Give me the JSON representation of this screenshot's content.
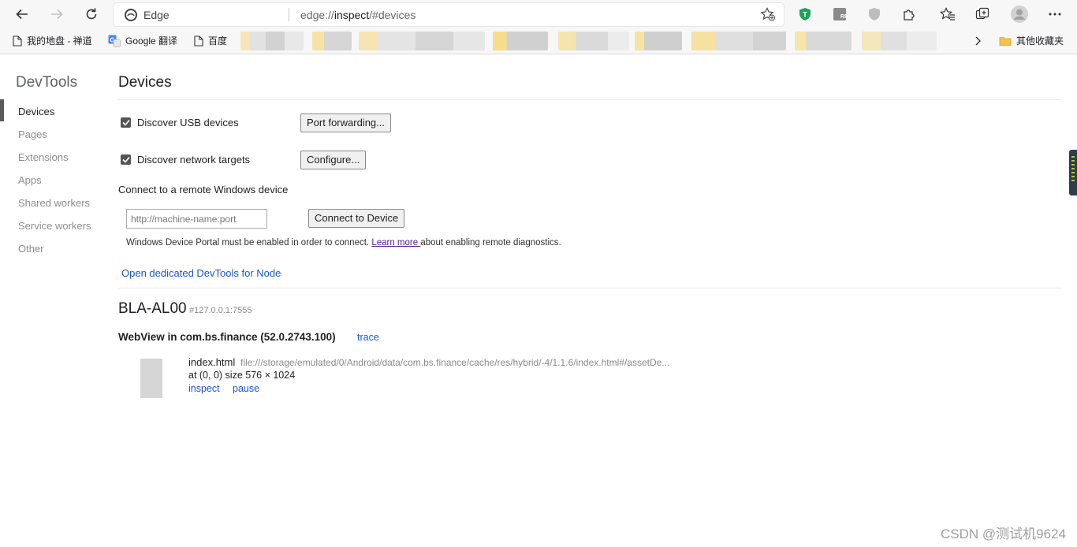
{
  "browser": {
    "edge_label": "Edge",
    "url_scheme": "edge://",
    "url_host": "inspect",
    "url_path": "/#devices"
  },
  "bookmarks": {
    "items": [
      "我的地盘 - 禅道",
      "Google 翻译",
      "百度"
    ],
    "other": "其他收藏夹"
  },
  "sidebar": {
    "title": "DevTools",
    "items": [
      "Devices",
      "Pages",
      "Extensions",
      "Apps",
      "Shared workers",
      "Service workers",
      "Other"
    ]
  },
  "devices": {
    "title": "Devices",
    "discover_usb": "Discover USB devices",
    "port_forwarding": "Port forwarding...",
    "discover_network": "Discover network targets",
    "configure": "Configure...",
    "connect_remote": "Connect to a remote Windows device",
    "input_placeholder": "http://machine-name:port",
    "connect_button": "Connect to Device",
    "hint_before": "Windows Device Portal must be enabled in order to connect. ",
    "hint_link": "Learn more ",
    "hint_after": "about enabling remote diagnostics.",
    "open_node": "Open dedicated DevTools for Node"
  },
  "device": {
    "name": "BLA-AL00",
    "serial": "#127.0.0.1:7555",
    "browser": "WebView in com.bs.finance (52.0.2743.100)",
    "trace": "trace",
    "target": {
      "name": "index.html",
      "url": "file:///storage/emulated/0/Android/data/com.bs.finance/cache/res/hybrid/-4/1.1.6/index.html#/assetDe...",
      "position": "at (0, 0)  size 576 × 1024",
      "inspect": "inspect",
      "pause": "pause"
    }
  },
  "watermark": "CSDN @测试机9624",
  "colors": {
    "link": "#1a58c9",
    "visited_link": "#551a8b",
    "toolbar_bg": "#f7f7f7",
    "shield_green": "#1aa35a"
  }
}
